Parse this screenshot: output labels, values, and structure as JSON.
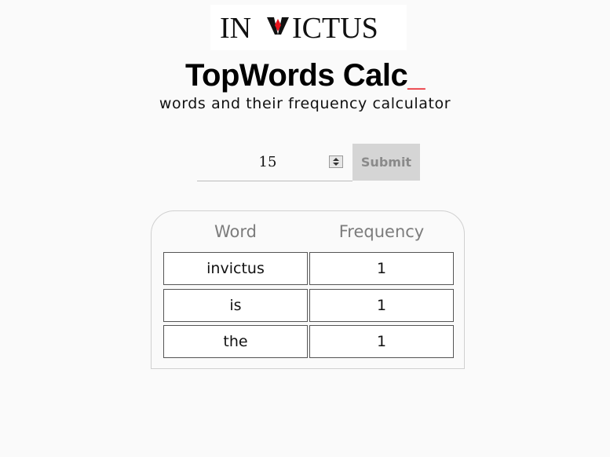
{
  "logo": {
    "text": "INVICTUS",
    "left": "IN",
    "right": "ICTUS",
    "accent_color": "#e8141c"
  },
  "header": {
    "title": "TopWords Calc",
    "cursor": "_",
    "cursor_color": "#e8141c",
    "subtitle": "words and their frequency calculator"
  },
  "form": {
    "count_value": "15",
    "submit_label": "Submit"
  },
  "results": {
    "columns": [
      "Word",
      "Frequency"
    ],
    "rows": [
      {
        "word": "invictus",
        "frequency": "1"
      },
      {
        "word": "is",
        "frequency": "1"
      },
      {
        "word": "the",
        "frequency": "1"
      }
    ]
  }
}
